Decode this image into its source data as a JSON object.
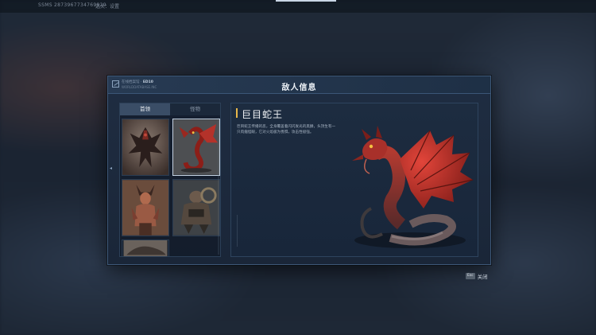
{
  "topbar": {
    "sid": "SSMS 2873967734769929",
    "stage": "选关：设置"
  },
  "modal": {
    "title": "敌人信息",
    "brand_line1_prefix": "在线档案馆 ·",
    "brand_line1_code": "ED10",
    "brand_line2": "WORLDDATABASE.INC"
  },
  "tabs": [
    {
      "label": "首领",
      "active": true
    },
    {
      "label": "怪物",
      "active": false
    }
  ],
  "thumbnails": [
    {
      "name": "winged-demon",
      "selected": false
    },
    {
      "name": "red-serpent-dragon",
      "selected": true
    },
    {
      "name": "horned-warrior",
      "selected": false
    },
    {
      "name": "armored-beast",
      "selected": false
    },
    {
      "name": "creature-partial",
      "selected": false
    }
  ],
  "detail": {
    "name": "巨目蛇王",
    "description": "巨目蛇王传播的恶，全身覆盖着闪闪发光的黑鳞，头顶生有一只肉瘤怪眼，它对火焰极为畏惧，攻击性极强。"
  },
  "close": {
    "key": "Esc",
    "label": "关闭"
  },
  "colors": {
    "accent": "#e8b84a",
    "panel": "#1d2c40",
    "border": "#3d5878",
    "tab_active": "#3a4d66"
  }
}
